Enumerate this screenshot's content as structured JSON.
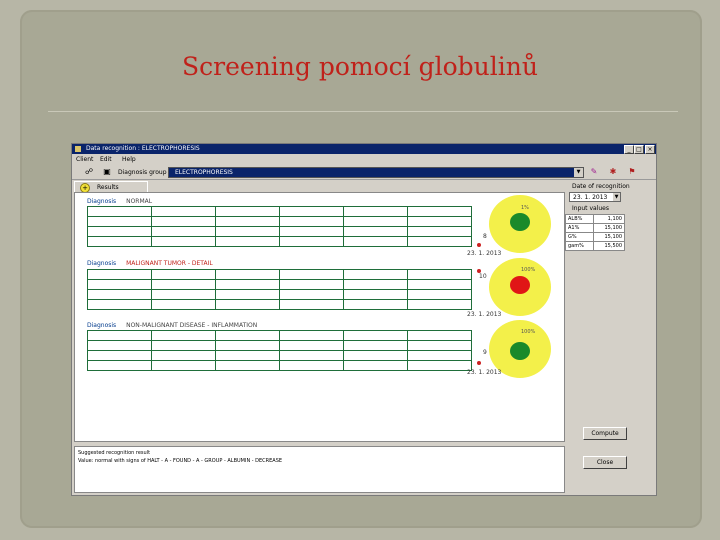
{
  "slide": {
    "title": "Screening pomocí globulinů"
  },
  "window": {
    "title": "Data recognition : ELECTROPHORESIS",
    "controls": [
      "_",
      "□",
      "×"
    ]
  },
  "menu": [
    "Client",
    "Edit",
    "Help"
  ],
  "toolbar": {
    "diagnosis_label": "Diagnosis group",
    "combo_value": "ELECTROPHORESIS"
  },
  "tab": {
    "label": "Results"
  },
  "diagnoses": [
    {
      "key": "Diagnosis",
      "value": "NORMAL",
      "pct": "1%",
      "tick": "8",
      "date": "23. 1. 2013"
    },
    {
      "key": "Diagnosis",
      "value": "MALIGNANT TUMOR - DETAIL",
      "pct": "100%",
      "tick": "10",
      "date": "23. 1. 2013"
    },
    {
      "key": "Diagnosis",
      "value": "NON-MALIGNANT DISEASE - INFLAMMATION",
      "pct": "100%",
      "tick": "9",
      "date": "23. 1. 2013"
    }
  ],
  "side": {
    "label": "Date of recognition",
    "combo_value": "23. 1. 2013",
    "values_header": "Input values",
    "rows": [
      {
        "name": "ALB%",
        "value": "1,100"
      },
      {
        "name": "A1%",
        "value": "15,100"
      },
      {
        "name": "G%",
        "value": "15,100"
      },
      {
        "name": "gam%",
        "value": "15,500"
      }
    ],
    "compute_button": "Compute",
    "close_button": "Close"
  },
  "bottom": {
    "line1": "Suggested recognition result",
    "line2": "Value: normal with signs of HALT - A - FOUND - A - GROUP - ALBUMIN - DECREASE"
  },
  "colors": {
    "title_red": "#c0211a",
    "circle_yellow": "#f3f04a",
    "dot_green": "#1a8a2a",
    "dot_red": "#e01616",
    "grid_green": "#1f6e3a"
  }
}
